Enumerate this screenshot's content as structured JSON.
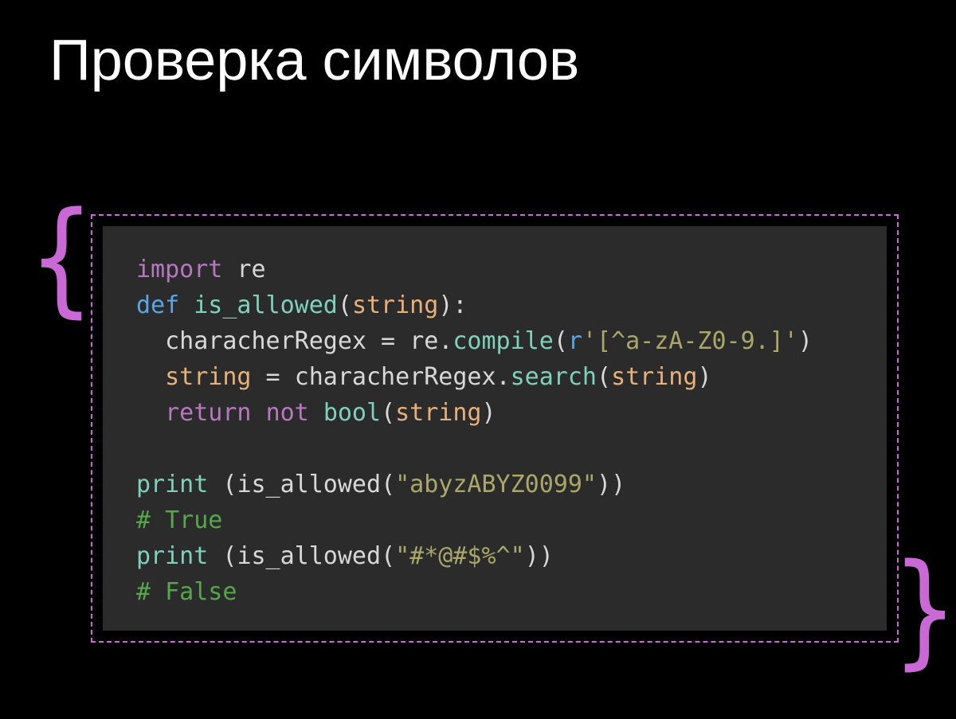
{
  "title": "Проверка символов",
  "braces": {
    "open": "{",
    "close": "}"
  },
  "code": {
    "l1_import": "import",
    "l1_mod": "re",
    "l2_def": "def",
    "l2_fn": "is_allowed",
    "l2_paren_open": "(",
    "l2_arg": "string",
    "l2_paren_close_colon": "):",
    "l3_var": "characherRegex",
    "l3_eq": " = ",
    "l3_mod": "re",
    "l3_dot": ".",
    "l3_call": "compile",
    "l3_po": "(",
    "l3_raw": "r",
    "l3_str": "'[^a-zA-Z0-9.]'",
    "l3_pc": ")",
    "l4_var": "string",
    "l4_eq": " = ",
    "l4_obj": "characherRegex",
    "l4_dot": ".",
    "l4_call": "search",
    "l4_po": "(",
    "l4_arg": "string",
    "l4_pc": ")",
    "l5_return": "return",
    "l5_not": "not",
    "l5_bool": "bool",
    "l5_po": "(",
    "l5_arg": "string",
    "l5_pc": ")",
    "l7_print": "print",
    "l7_sp": " ",
    "l7_po": "(",
    "l7_fn": "is_allowed",
    "l7_po2": "(",
    "l7_str": "\"abyzABYZ0099\"",
    "l7_pc2": ")",
    "l7_pc": ")",
    "l8_cmt": "# True",
    "l9_print": "print",
    "l9_sp": " ",
    "l9_po": "(",
    "l9_fn": "is_allowed",
    "l9_po2": "(",
    "l9_str": "\"#*@#$%^\"",
    "l9_pc2": ")",
    "l9_pc": ")",
    "l10_cmt": "# False"
  }
}
